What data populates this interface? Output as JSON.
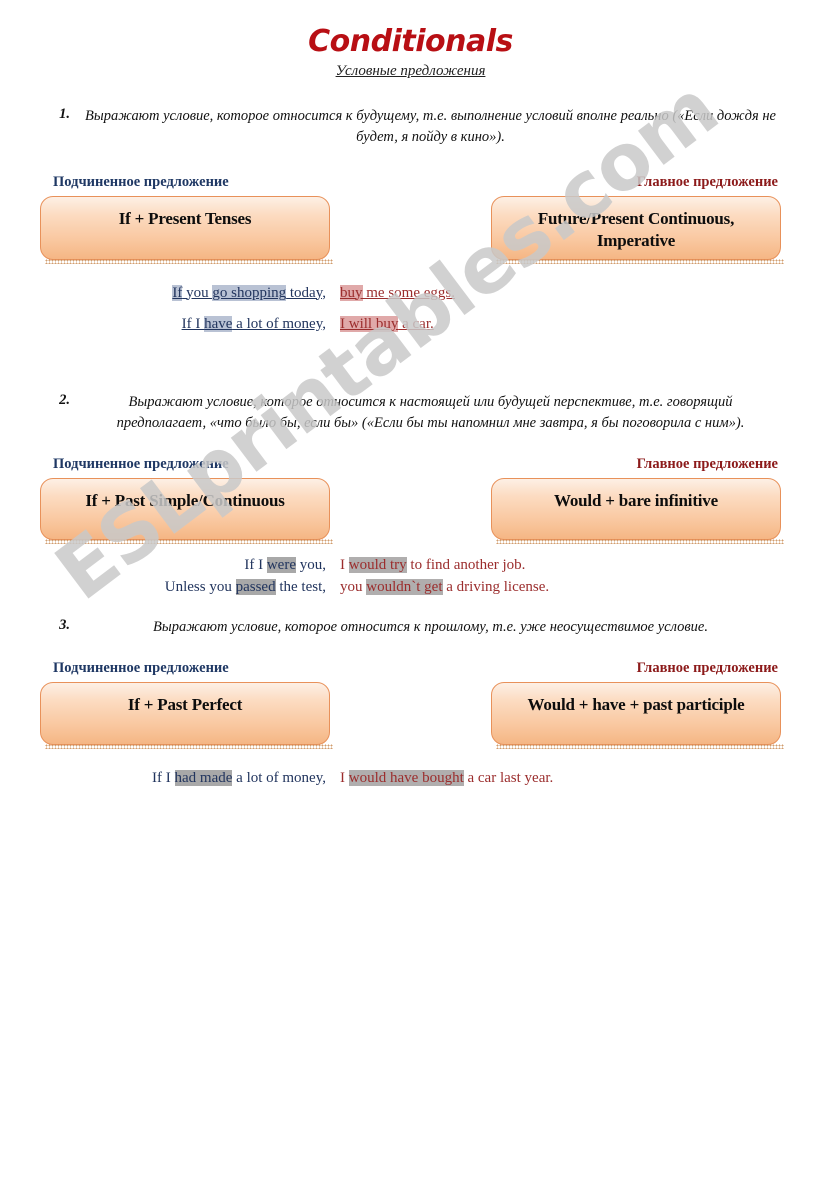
{
  "watermark": {
    "text": "ESLprintables.com"
  },
  "header": {
    "title": "Conditionals",
    "subtitle": "Условные предложения",
    "title_color": "#b80f14"
  },
  "labels": {
    "subordinate": "Подчиненное предложение",
    "main": "Главное предложение",
    "subordinate_color": "#1f3864",
    "main_color": "#8c1a1a"
  },
  "sections": [
    {
      "number": "1.",
      "description": "Выражают условие, которое относится к будущему, т.е. выполнение условий вполне реально («Если дождя не будет, я пойду в кино»).",
      "left_box": "If + Present Tenses",
      "right_box": "Future/Present Continuous, Imperative",
      "examples": [
        {
          "cond": [
            {
              "t": "If",
              "hl": "blue"
            },
            {
              "t": " you ",
              "hl": ""
            },
            {
              "t": "go shopping",
              "hl": "blue"
            },
            {
              "t": " today,",
              "hl": ""
            }
          ],
          "res": [
            {
              "t": "buy",
              "hl": "pink"
            },
            {
              "t": " me some eggs.",
              "hl": ""
            }
          ],
          "underline": true
        },
        {
          "cond": [
            {
              "t": "If I ",
              "hl": ""
            },
            {
              "t": "have",
              "hl": "blue"
            },
            {
              "t": " a lot of money,",
              "hl": ""
            }
          ],
          "res": [
            {
              "t": "I will buy",
              "hl": "pink"
            },
            {
              "t": " a car.",
              "hl": ""
            }
          ],
          "underline": true
        }
      ]
    },
    {
      "number": "2.",
      "description": "Выражают условие, которое относится к настоящей или будущей перспективе, т.е. говорящий предполагает, «что было бы, если бы» («Если бы ты напомнил мне завтра, я бы поговорила с ним»).",
      "left_box": "If + Past Simple/Continuous",
      "right_box": "Would + bare infinitive",
      "examples": [
        {
          "cond": [
            {
              "t": "If I ",
              "hl": ""
            },
            {
              "t": "were",
              "hl": "grey"
            },
            {
              "t": " you,",
              "hl": ""
            }
          ],
          "res": [
            {
              "t": "I ",
              "hl": ""
            },
            {
              "t": "would try",
              "hl": "grey2"
            },
            {
              "t": " to find another job.",
              "hl": ""
            }
          ],
          "underline": false
        },
        {
          "cond": [
            {
              "t": "Unless you ",
              "hl": ""
            },
            {
              "t": "passed",
              "hl": "grey"
            },
            {
              "t": " the test,",
              "hl": ""
            }
          ],
          "res": [
            {
              "t": "you ",
              "hl": ""
            },
            {
              "t": "wouldn`t get",
              "hl": "grey2"
            },
            {
              "t": " a driving license.",
              "hl": ""
            }
          ],
          "underline": false
        }
      ]
    },
    {
      "number": "3.",
      "description": "Выражают условие, которое относится к прошлому, т.е. уже неосуществимое условие.",
      "left_box": "If + Past Perfect",
      "right_box": "Would + have + past participle",
      "examples": [
        {
          "cond": [
            {
              "t": "If I ",
              "hl": ""
            },
            {
              "t": "had made",
              "hl": "grey"
            },
            {
              "t": " a lot of money,",
              "hl": ""
            }
          ],
          "res": [
            {
              "t": "I ",
              "hl": ""
            },
            {
              "t": "would have bought",
              "hl": "grey2"
            },
            {
              "t": " a car last year.",
              "hl": ""
            }
          ],
          "underline": false
        }
      ]
    }
  ]
}
